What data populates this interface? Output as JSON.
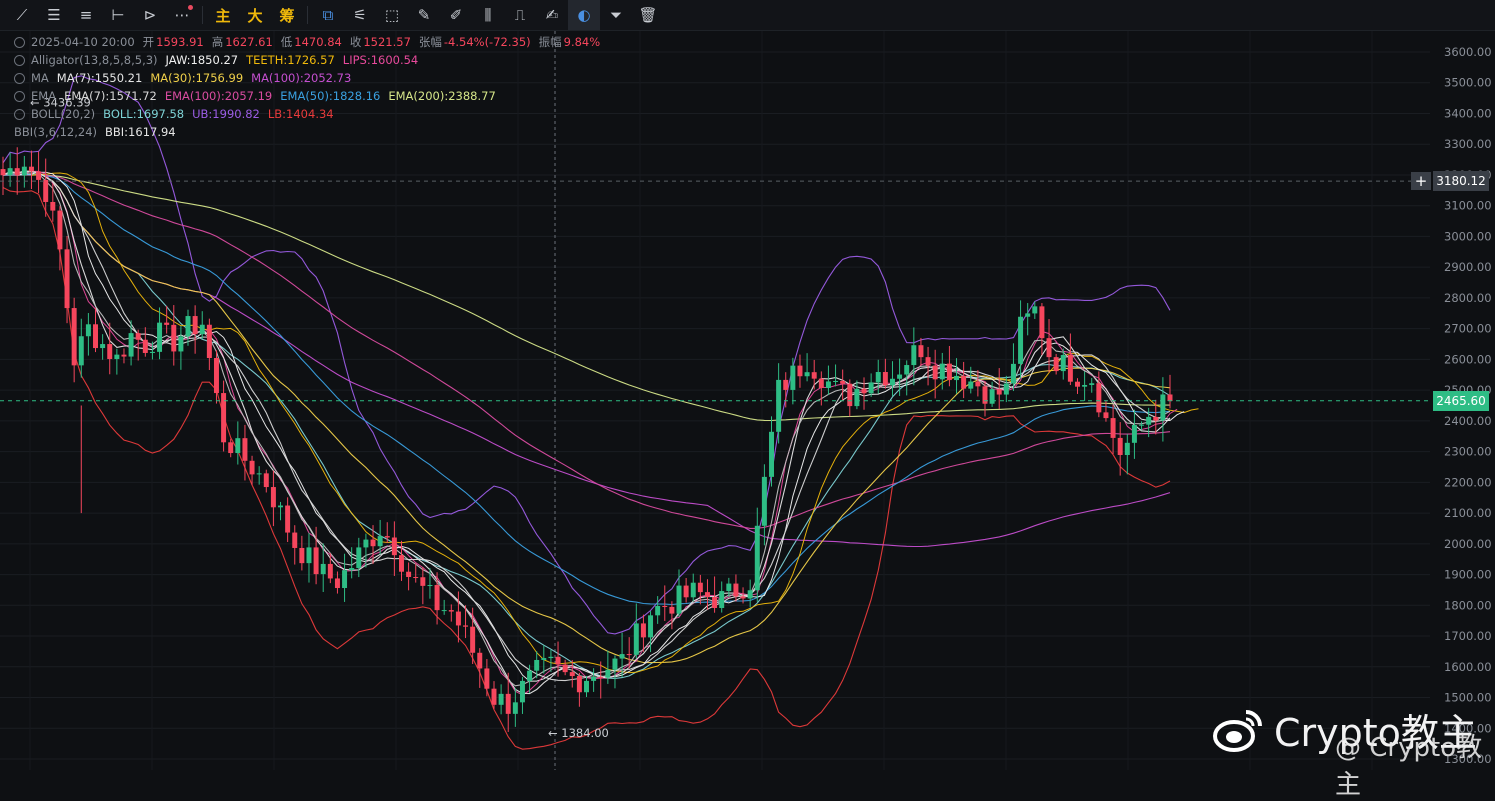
{
  "toolbar": {
    "tools": [
      {
        "name": "trend-line-icon",
        "glyph": "⟋"
      },
      {
        "name": "horizontal-lines-icon",
        "glyph": "☰"
      },
      {
        "name": "parallel-lines-icon",
        "glyph": "≡"
      },
      {
        "name": "crosshair-line-icon",
        "glyph": "⊢"
      },
      {
        "name": "arrow-tool-icon",
        "glyph": "⊳"
      },
      {
        "name": "more-icon",
        "glyph": "⋯"
      }
    ],
    "cn_buttons": [
      "主",
      "大",
      "筹"
    ],
    "tools2": [
      {
        "name": "indicator-icon",
        "glyph": "⧉"
      },
      {
        "name": "draw-settings-icon",
        "glyph": "⚟"
      },
      {
        "name": "layout-icon",
        "glyph": "⬚"
      },
      {
        "name": "ruler-icon",
        "glyph": "✎"
      },
      {
        "name": "brush-icon",
        "glyph": "✐"
      },
      {
        "name": "candle-type-icon",
        "glyph": "⫼"
      },
      {
        "name": "lock-icon",
        "glyph": "⎍"
      },
      {
        "name": "note-icon",
        "glyph": "✍"
      },
      {
        "name": "magnet-icon",
        "glyph": "◐"
      },
      {
        "name": "filter-icon",
        "glyph": "⏷"
      },
      {
        "name": "trash-icon",
        "glyph": "🗑"
      }
    ]
  },
  "legend": {
    "ohlc": {
      "date": "2025-04-10 20:00",
      "open_label": "开",
      "open": "1593.91",
      "high_label": "高",
      "high": "1627.61",
      "low_label": "低",
      "low": "1470.84",
      "close_label": "收",
      "close": "1521.57",
      "change_label": "张幅",
      "change": "-4.54%(-72.35)",
      "amp_label": "振幅",
      "amp": "9.84%"
    },
    "alligator": {
      "label": "Alligator(13,8,5,8,5,3)",
      "jaw": "JAW:1850.27",
      "teeth": "TEETH:1726.57",
      "lips": "LIPS:1600.54"
    },
    "ma": {
      "label": "MA",
      "ma7": "MA(7):1550.21",
      "ma30": "MA(30):1756.99",
      "ma100": "MA(100):2052.73"
    },
    "ema": {
      "label": "EMA",
      "ema7": "EMA(7):1571.72",
      "ema100": "EMA(100):2057.19",
      "ema50": "EMA(50):1828.16",
      "ema200": "EMA(200):2388.77"
    },
    "boll": {
      "label": "BOLL(20,2)",
      "boll": "BOLL:1697.58",
      "ub": "UB:1990.82",
      "lb": "LB:1404.34"
    },
    "bbi": {
      "label": "BBI(3,6,12,24)",
      "bbi": "BBI:1617.94"
    }
  },
  "colors": {
    "up": "#2ebd85",
    "down": "#f6465d",
    "jaw": "#f0b90b",
    "teeth": "#f0b90b",
    "lips": "#e84a9c",
    "ma7": "#e6e6e6",
    "ma30": "#f0d04a",
    "ma100": "#c54fd0",
    "ema7": "#d8d8d8",
    "ema100": "#d94ca0",
    "ema50": "#3aa0e0",
    "ema200": "#d6e68a",
    "boll": "#7ed3d6",
    "ub": "#9b5de5",
    "lb": "#e83b3b",
    "bbi": "#d8d8d8"
  },
  "chart_data": {
    "type": "line",
    "ylim": [
      1300,
      3650
    ],
    "y_ticks": [
      3600,
      3500,
      3400,
      3300,
      3200,
      3100,
      3000,
      2900,
      2800,
      2700,
      2600,
      2500,
      2400,
      2300,
      2200,
      2100,
      2000,
      1900,
      1800,
      1700,
      1600,
      1500,
      1400,
      1300
    ],
    "y_tick_labels": [
      "3600.00",
      "3500.00",
      "3400.00",
      "3300.00",
      "3200.00",
      "3100.00",
      "3000.00",
      "2900.00",
      "2800.00",
      "2700.00",
      "2600.00",
      "2500.00",
      "2400.00",
      "2300.00",
      "2200.00",
      "2100.00",
      "2000.00",
      "1900.00",
      "1800.00",
      "1700.00",
      "1600.00",
      "1500.00",
      "1400.00",
      "1300.00"
    ],
    "hline_prices": [
      3180.12,
      2465.6
    ],
    "hline_labels": [
      "3180.12",
      "2465.60"
    ],
    "high_marker": {
      "price": 3436.39,
      "label": "3436.39"
    },
    "low_marker": {
      "price": 1384.0,
      "label": "1384.00"
    },
    "price_path": [
      [
        0,
        3200
      ],
      [
        3,
        3250
      ],
      [
        6,
        3150
      ],
      [
        8,
        2950
      ],
      [
        10,
        2600
      ],
      [
        12,
        2700
      ],
      [
        14,
        2650
      ],
      [
        16,
        2600
      ],
      [
        18,
        2680
      ],
      [
        20,
        2650
      ],
      [
        22,
        2680
      ],
      [
        24,
        2660
      ],
      [
        26,
        2700
      ],
      [
        28,
        2720
      ],
      [
        29,
        2600
      ],
      [
        31,
        2350
      ],
      [
        33,
        2300
      ],
      [
        35,
        2250
      ],
      [
        37,
        2200
      ],
      [
        39,
        2100
      ],
      [
        41,
        2000
      ],
      [
        43,
        1950
      ],
      [
        45,
        1900
      ],
      [
        47,
        1880
      ],
      [
        49,
        1930
      ],
      [
        51,
        2000
      ],
      [
        53,
        2050
      ],
      [
        55,
        2000
      ],
      [
        57,
        1900
      ],
      [
        59,
        1850
      ],
      [
        61,
        1800
      ],
      [
        63,
        1780
      ],
      [
        65,
        1700
      ],
      [
        67,
        1600
      ],
      [
        69,
        1500
      ],
      [
        71,
        1480
      ],
      [
        73,
        1530
      ],
      [
        75,
        1580
      ],
      [
        77,
        1600
      ],
      [
        79,
        1570
      ],
      [
        81,
        1560
      ],
      [
        83,
        1580
      ],
      [
        85,
        1600
      ],
      [
        87,
        1620
      ],
      [
        89,
        1700
      ],
      [
        91,
        1780
      ],
      [
        93,
        1800
      ],
      [
        95,
        1820
      ],
      [
        97,
        1840
      ],
      [
        99,
        1830
      ],
      [
        101,
        1820
      ],
      [
        103,
        1850
      ],
      [
        105,
        1880
      ],
      [
        107,
        2200
      ],
      [
        109,
        2500
      ],
      [
        111,
        2550
      ],
      [
        113,
        2600
      ],
      [
        115,
        2550
      ],
      [
        117,
        2500
      ],
      [
        119,
        2480
      ],
      [
        121,
        2530
      ],
      [
        123,
        2560
      ],
      [
        125,
        2550
      ],
      [
        127,
        2600
      ],
      [
        129,
        2640
      ],
      [
        131,
        2580
      ],
      [
        133,
        2570
      ],
      [
        135,
        2540
      ],
      [
        137,
        2520
      ],
      [
        139,
        2480
      ],
      [
        141,
        2500
      ],
      [
        143,
        2700
      ],
      [
        145,
        2760
      ],
      [
        147,
        2620
      ],
      [
        149,
        2580
      ],
      [
        151,
        2550
      ],
      [
        153,
        2540
      ],
      [
        155,
        2400
      ],
      [
        157,
        2300
      ],
      [
        159,
        2350
      ],
      [
        161,
        2420
      ],
      [
        163,
        2450
      ]
    ],
    "series": []
  },
  "watermark": {
    "text": "Crypto教主",
    "handle": "@ Crypto教主"
  }
}
